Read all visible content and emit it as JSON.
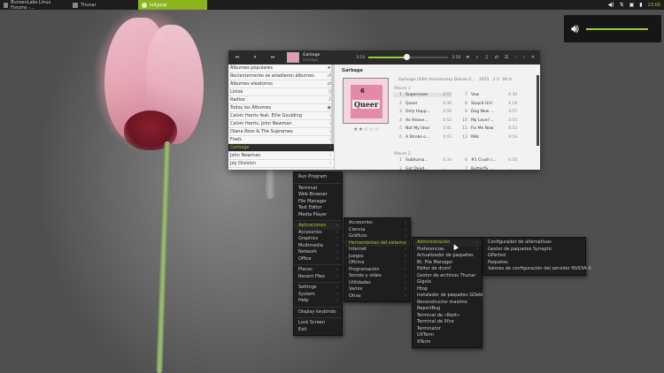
{
  "taskbar": {
    "tasks": [
      {
        "label": "BunsenLabs Linux Forums -..."
      },
      {
        "label": "Thunar"
      },
      {
        "label": "lollypop"
      }
    ],
    "clock": "23:00"
  },
  "osd": {
    "volume_fraction": 0.95
  },
  "player": {
    "now_playing": {
      "title": "Garbage",
      "artist": "Garbage"
    },
    "time_elapsed": "3:54",
    "time_total": "3:56",
    "progress_fraction": 0.48,
    "sidebar": [
      {
        "label": "Álbumes populares",
        "icon": "star-icon"
      },
      {
        "label": "Recientemente se añadieron álbumes",
        "icon": "history-icon"
      },
      {
        "label": "Álbumes aleatorios",
        "icon": "shuffle-icon"
      },
      {
        "label": "Listas",
        "icon": "document-icon"
      },
      {
        "label": "Radios",
        "icon": "microphone-icon"
      },
      {
        "label": "Todos los Álbumes",
        "icon": "disc-icon"
      },
      {
        "label": "Calvin Harris feat. Ellie Goulding",
        "icon": "chevron-right-icon"
      },
      {
        "label": "Calvin Harris, John Newman",
        "icon": "chevron-right-icon"
      },
      {
        "label": "Diana Ross & The Supremes",
        "icon": "chevron-right-icon"
      },
      {
        "label": "Foals",
        "icon": "chevron-right-icon"
      },
      {
        "label": "Garbage",
        "icon": "chevron-right-icon",
        "selected": true
      },
      {
        "label": "John Newman",
        "icon": "chevron-right-icon"
      },
      {
        "label": "Joy Division",
        "icon": "chevron-right-icon"
      }
    ],
    "artist_title": "Garbage",
    "album": {
      "name": "Garbage (20th Anniversary Deluxe E...",
      "year": "2015",
      "count": "2 h",
      "length": "18 m",
      "cover_top": "6",
      "cover_word": "Queer",
      "rating": "★★☆☆☆",
      "disc1_label": "Álbum 1",
      "disc2_label": "Álbum 2",
      "disc1_left": [
        {
          "n": "1",
          "title": "Supervixen",
          "dur": "3:55",
          "playing": true
        },
        {
          "n": "2",
          "title": "Queer",
          "dur": "4:36"
        },
        {
          "n": "3",
          "title": "Only Happ...",
          "dur": "3:56"
        },
        {
          "n": "4",
          "title": "As Heave...",
          "dur": "4:52"
        },
        {
          "n": "5",
          "title": "Not My Idea",
          "dur": "3:41"
        },
        {
          "n": "6",
          "title": "A Stroke o...",
          "dur": "4:43"
        }
      ],
      "disc1_right": [
        {
          "n": "7",
          "title": "Vow",
          "dur": "4:30"
        },
        {
          "n": "8",
          "title": "Stupid Girl",
          "dur": "4:19"
        },
        {
          "n": "9",
          "title": "Dog New ...",
          "dur": "3:57"
        },
        {
          "n": "10",
          "title": "My Lover'...",
          "dur": "3:55"
        },
        {
          "n": "11",
          "title": "Fix Me Now",
          "dur": "4:53"
        },
        {
          "n": "12",
          "title": "Milk",
          "dur": "3:54"
        }
      ],
      "disc2_left": [
        {
          "n": "1",
          "title": "Subhuma...",
          "dur": "4:34"
        },
        {
          "n": "2",
          "title": "Got Dead...",
          "dur": "..."
        }
      ],
      "disc2_right": [
        {
          "n": "6",
          "title": "#1 Crush (...",
          "dur": "4:50"
        },
        {
          "n": "7",
          "title": "Butterfly ...",
          "dur": "..."
        }
      ]
    }
  },
  "menus": {
    "root": [
      {
        "label": "Run Program"
      },
      {
        "sep": true
      },
      {
        "label": "Terminal"
      },
      {
        "label": "Web Browser"
      },
      {
        "label": "File Manager"
      },
      {
        "label": "Text Editor"
      },
      {
        "label": "Media Player"
      },
      {
        "sep": true
      },
      {
        "label": "Aplicaciones",
        "sub": true,
        "hl": true
      },
      {
        "label": "Accesorios",
        "sub": true
      },
      {
        "label": "Graphics",
        "sub": true
      },
      {
        "label": "Multimedia",
        "sub": true
      },
      {
        "label": "Network",
        "sub": true
      },
      {
        "label": "Office",
        "sub": true
      },
      {
        "sep": true
      },
      {
        "label": "Places",
        "sub": true
      },
      {
        "label": "Recent Files",
        "sub": true
      },
      {
        "sep": true
      },
      {
        "label": "Settings",
        "sub": true
      },
      {
        "label": "System",
        "sub": true
      },
      {
        "label": "Help",
        "sub": true
      },
      {
        "sep": true
      },
      {
        "label": "Display keybinds",
        "sub": true
      },
      {
        "sep": true
      },
      {
        "label": "Lock Screen"
      },
      {
        "label": "Exit"
      }
    ],
    "apps": [
      {
        "label": "Accesorios",
        "sub": true
      },
      {
        "label": "Ciencia",
        "sub": true
      },
      {
        "label": "Gráficos",
        "sub": true
      },
      {
        "label": "Herramientas del sistema",
        "sub": true,
        "hl": true
      },
      {
        "label": "Internet",
        "sub": true
      },
      {
        "label": "Juegos",
        "sub": true
      },
      {
        "label": "Oficina",
        "sub": true
      },
      {
        "label": "Programación",
        "sub": true
      },
      {
        "label": "Sonido y vídeo",
        "sub": true
      },
      {
        "label": "Utilidades",
        "sub": true
      },
      {
        "label": "Varios",
        "sub": true
      },
      {
        "label": "Otras",
        "sub": true
      }
    ],
    "system_tools": [
      {
        "label": "Administración",
        "sub": true,
        "hl": true
      },
      {
        "label": "Preferencias",
        "sub": true
      },
      {
        "label": "Actualizador de paquetes"
      },
      {
        "label": "Bt. File Manager"
      },
      {
        "label": "Editor de dconf"
      },
      {
        "label": "Gestor de archivos Thunar"
      },
      {
        "label": "Gigolo"
      },
      {
        "label": "Htop"
      },
      {
        "label": "Instalador de paquetes GDebi"
      },
      {
        "label": "Reconstructor maximo"
      },
      {
        "label": "ReportBug"
      },
      {
        "label": "Terminal de «Root»"
      },
      {
        "label": "Terminal de Xfce"
      },
      {
        "label": "Terminator"
      },
      {
        "label": "UXTerm"
      },
      {
        "label": "XTerm"
      }
    ],
    "admin": [
      {
        "label": "Configurador de alternativas"
      },
      {
        "label": "Gestor de paquetes Synaptic"
      },
      {
        "label": "GParted"
      },
      {
        "label": "Paquetes"
      },
      {
        "label": "Valores de configuración del servidor NVIDIA X"
      }
    ]
  }
}
